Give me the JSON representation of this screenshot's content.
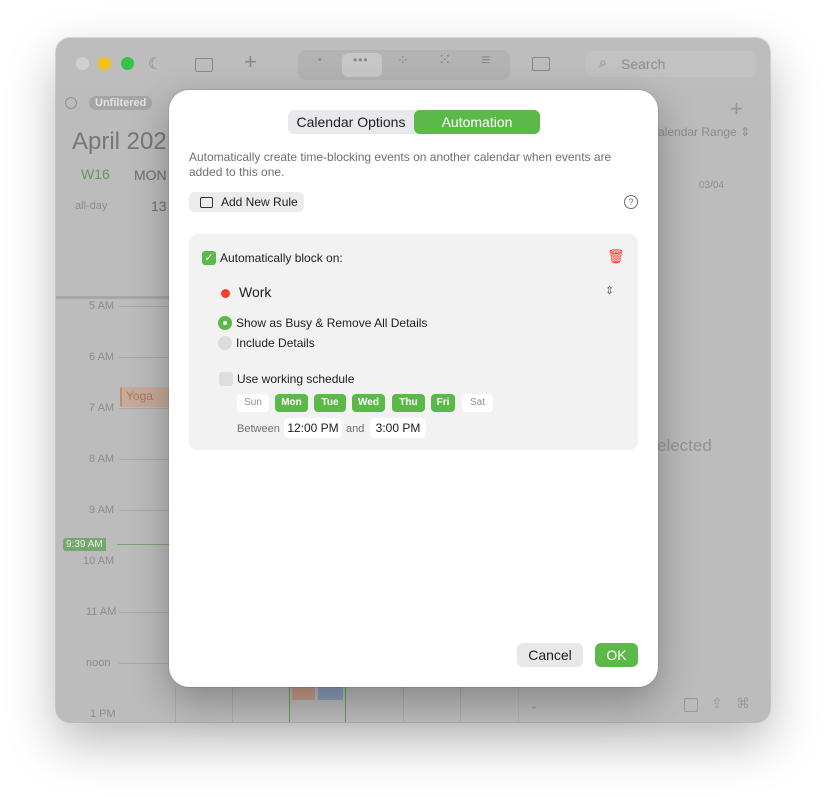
{
  "background": {
    "toolbar": {
      "search_placeholder": "Search"
    },
    "filter_badge": "Unfiltered",
    "month_title": "April 202",
    "week_label": "W16",
    "day_label": "MON",
    "day_number": "13",
    "allday_label": "all-day",
    "hours": [
      "5 AM",
      "6 AM",
      "7 AM",
      "8 AM",
      "9 AM",
      "10 AM",
      "11 AM",
      "noon",
      "1 PM"
    ],
    "current_time": "9:39 AM",
    "event_label": "Yoga",
    "right_panel": {
      "range_label": "alendar Range",
      "date_label": "03/04",
      "empty_text": "elected"
    }
  },
  "modal": {
    "tabs": [
      "Calendar Options",
      "Automation"
    ],
    "active_tab": "Automation",
    "description": "Automatically create time-blocking events on another calendar when events are added to this one.",
    "add_rule_label": "Add New Rule",
    "help_symbol": "?",
    "rule": {
      "enabled_label": "Automatically block on:",
      "calendar_name": "Work",
      "calendar_color": "#ff3b30",
      "option_busy": "Show as Busy & Remove All Details",
      "option_details": "Include Details",
      "working_schedule_label": "Use working schedule",
      "days": [
        {
          "label": "Sun",
          "active": false
        },
        {
          "label": "Mon",
          "active": true
        },
        {
          "label": "Tue",
          "active": true
        },
        {
          "label": "Wed",
          "active": true
        },
        {
          "label": "Thu",
          "active": true
        },
        {
          "label": "Fri",
          "active": true
        },
        {
          "label": "Sat",
          "active": false
        }
      ],
      "between_label": "Between",
      "start_time": "12:00 PM",
      "and_label": "and",
      "end_time": "3:00 PM"
    },
    "cancel_label": "Cancel",
    "ok_label": "OK"
  },
  "colors": {
    "accent": "#5bb947",
    "danger": "#ff3b30"
  }
}
